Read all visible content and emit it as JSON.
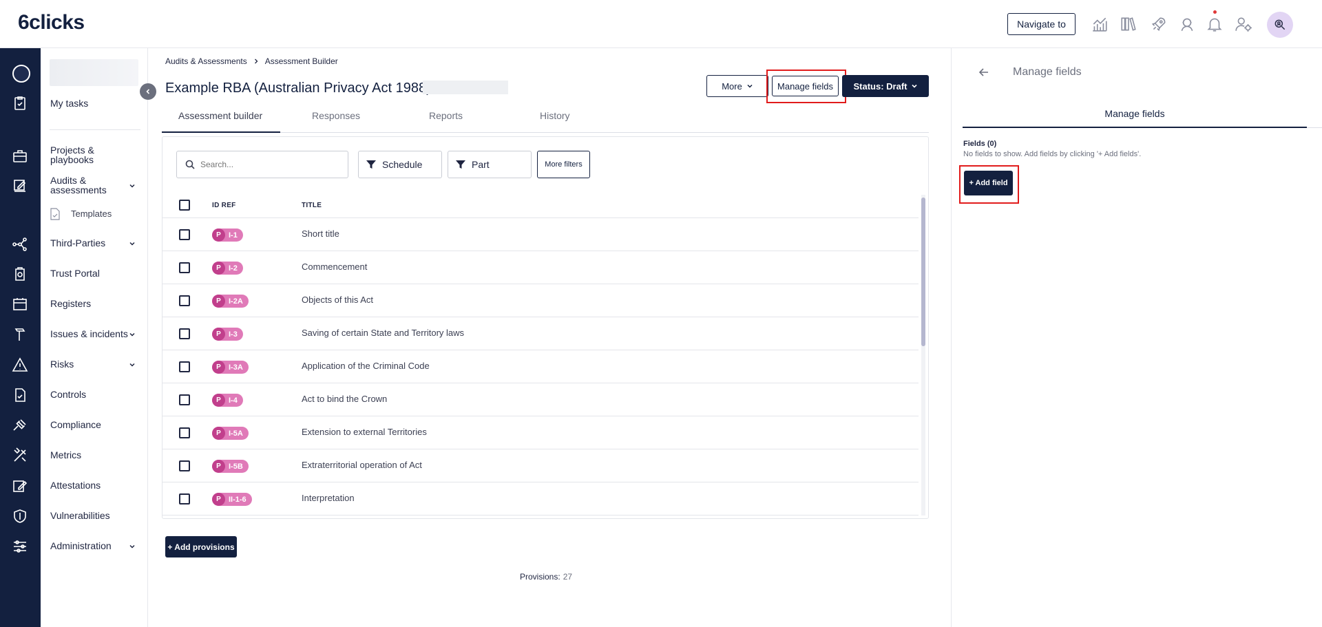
{
  "app": {
    "logo": "6clicks"
  },
  "topbar": {
    "navigate_label": "Navigate to",
    "icons": [
      "analytics-icon",
      "library-icon",
      "rocket-icon",
      "support-agent-icon",
      "bell-icon",
      "user-settings-icon"
    ],
    "avatar_icon": "search-user-icon"
  },
  "sidemenu": {
    "my_tasks": "My tasks",
    "projects": "Projects & playbooks",
    "audits": "Audits & assessments",
    "templates": "Templates",
    "third_parties": "Third-Parties",
    "trust_portal": "Trust Portal",
    "registers": "Registers",
    "issues": "Issues & incidents",
    "risks": "Risks",
    "controls": "Controls",
    "compliance": "Compliance",
    "metrics": "Metrics",
    "attestations": "Attestations",
    "vulnerabilities": "Vulnerabilities",
    "administration": "Administration"
  },
  "breadcrumb": {
    "root": "Audits & Assessments",
    "current": "Assessment Builder"
  },
  "page": {
    "title": "Example RBA (Australian Privacy Act 1988)"
  },
  "actions": {
    "more": "More",
    "manage_fields": "Manage fields",
    "status": "Status: Draft"
  },
  "tabs": [
    "Assessment builder",
    "Responses",
    "Reports",
    "History"
  ],
  "filters": {
    "search_placeholder": "Search...",
    "schedule": "Schedule",
    "part": "Part",
    "more_filters": "More filters"
  },
  "table": {
    "headers": {
      "id_ref": "ID REF",
      "title": "TITLE"
    },
    "rows": [
      {
        "badge": "P",
        "id": "I-1",
        "title": "Short title"
      },
      {
        "badge": "P",
        "id": "I-2",
        "title": "Commencement"
      },
      {
        "badge": "P",
        "id": "I-2A",
        "title": "Objects of this Act"
      },
      {
        "badge": "P",
        "id": "I-3",
        "title": "Saving of certain State and Territory laws"
      },
      {
        "badge": "P",
        "id": "I-3A",
        "title": "Application of the Criminal Code"
      },
      {
        "badge": "P",
        "id": "I-4",
        "title": "Act to bind the Crown"
      },
      {
        "badge": "P",
        "id": "I-5A",
        "title": "Extension to external Territories"
      },
      {
        "badge": "P",
        "id": "I-5B",
        "title": "Extraterritorial operation of Act"
      },
      {
        "badge": "P",
        "id": "II-1-6",
        "title": "Interpretation"
      }
    ]
  },
  "footer": {
    "add_provisions": "+ Add provisions",
    "provisions_label": "Provisions:",
    "provisions_count": "27"
  },
  "panel": {
    "title": "Manage fields",
    "tab": "Manage fields",
    "fields_count": "Fields (0)",
    "empty_text": "No fields to show. Add fields by clicking '+ Add fields'.",
    "add_field": "+ Add field"
  }
}
